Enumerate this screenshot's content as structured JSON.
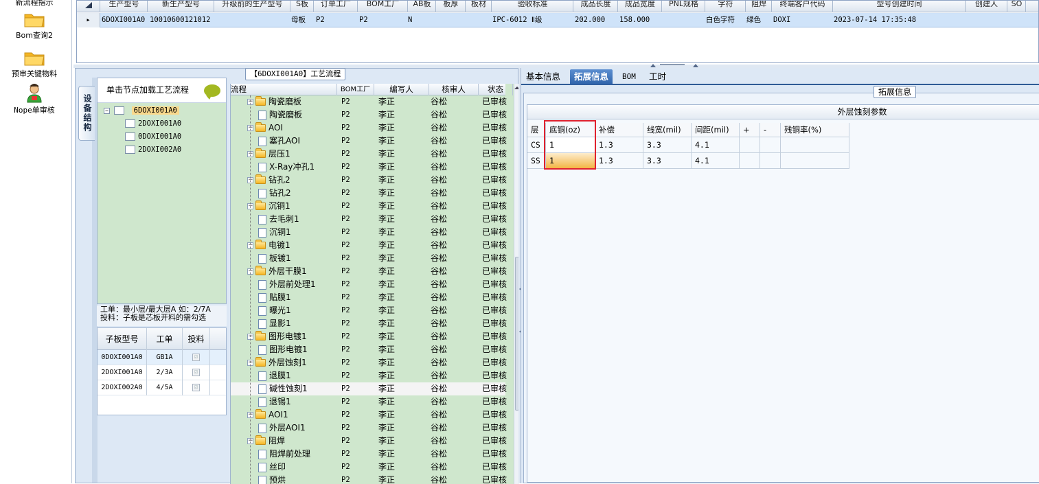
{
  "leftnav": {
    "items": [
      {
        "label": "新流程指示",
        "icon": "folder-icon"
      },
      {
        "label": "Bom查询2",
        "icon": "folder-icon"
      },
      {
        "label": "预审关键物料",
        "icon": "folder-icon"
      },
      {
        "label": "Nope单审核",
        "icon": "user-icon"
      }
    ]
  },
  "topgrid": {
    "columns": [
      "生产型号",
      "新生产型号",
      "升级前的生产型号",
      "S板",
      "订单工厂",
      "BOM工厂",
      "AB板",
      "板厚",
      "板材",
      "验收标准",
      "成品长度",
      "成品宽度",
      "PNL规格",
      "字符",
      "阻焊",
      "终端客户代码",
      "型号创建时间",
      "创建人",
      "SO"
    ],
    "row": {
      "model": "6DOXI001A0",
      "new_model": "10010600121012",
      "s_board": "母板",
      "order_factory": "P2",
      "bom_factory": "P2",
      "ab_board": "N",
      "standard": "IPC-6012 Ⅱ级",
      "length": "202.000",
      "width": "158.000",
      "char": "白色字符",
      "solder": "绿色",
      "customer": "DOXI",
      "created": "2023-07-14 17:35:48"
    }
  },
  "process": {
    "title": "【6DOXI001A0】工艺流程",
    "vtab_label": "设备结构",
    "tree_header": "单击节点加载工艺流程",
    "tree": {
      "root": "6DOXI001A0",
      "children": [
        "2DOXI001A0",
        "0DOXI001A0",
        "2DOXI002A0"
      ]
    },
    "notes": {
      "line1": "工单：最小层/最大层A 如：2/7A",
      "line2": "投料：子板是芯板开料的需勾选"
    },
    "subgrid": {
      "headers": [
        "子板型号",
        "工单",
        "投料"
      ],
      "rows": [
        {
          "model": "0DOXI001A0",
          "order": "GB1A",
          "check": "☑"
        },
        {
          "model": "2DOXI001A0",
          "order": "2/3A",
          "check": "☑"
        },
        {
          "model": "2DOXI002A0",
          "order": "4/5A",
          "check": "☑"
        }
      ]
    },
    "table": {
      "headers": [
        "流程",
        "BOM工厂",
        "编写人",
        "核审人",
        "状态"
      ],
      "rows": [
        {
          "name": "陶瓷磨板",
          "level": 0,
          "factory": "P2",
          "writer": "李正",
          "reviewer": "谷松",
          "status": "已审核"
        },
        {
          "name": "陶瓷磨板",
          "level": 1,
          "factory": "P2",
          "writer": "李正",
          "reviewer": "谷松",
          "status": "已审核"
        },
        {
          "name": "AOI",
          "level": 0,
          "factory": "P2",
          "writer": "李正",
          "reviewer": "谷松",
          "status": "已审核"
        },
        {
          "name": "塞孔AOI",
          "level": 1,
          "factory": "P2",
          "writer": "李正",
          "reviewer": "谷松",
          "status": "已审核"
        },
        {
          "name": "层压1",
          "level": 0,
          "factory": "P2",
          "writer": "李正",
          "reviewer": "谷松",
          "status": "已审核"
        },
        {
          "name": "X-Ray冲孔1",
          "level": 1,
          "factory": "P2",
          "writer": "李正",
          "reviewer": "谷松",
          "status": "已审核"
        },
        {
          "name": "钻孔2",
          "level": 0,
          "factory": "P2",
          "writer": "李正",
          "reviewer": "谷松",
          "status": "已审核"
        },
        {
          "name": "钻孔2",
          "level": 1,
          "factory": "P2",
          "writer": "李正",
          "reviewer": "谷松",
          "status": "已审核"
        },
        {
          "name": "沉铜1",
          "level": 0,
          "factory": "P2",
          "writer": "李正",
          "reviewer": "谷松",
          "status": "已审核"
        },
        {
          "name": "去毛刺1",
          "level": 1,
          "factory": "P2",
          "writer": "李正",
          "reviewer": "谷松",
          "status": "已审核"
        },
        {
          "name": "沉铜1",
          "level": 1,
          "factory": "P2",
          "writer": "李正",
          "reviewer": "谷松",
          "status": "已审核"
        },
        {
          "name": "电镀1",
          "level": 0,
          "factory": "P2",
          "writer": "李正",
          "reviewer": "谷松",
          "status": "已审核"
        },
        {
          "name": "板镀1",
          "level": 1,
          "factory": "P2",
          "writer": "李正",
          "reviewer": "谷松",
          "status": "已审核"
        },
        {
          "name": "外层干膜1",
          "level": 0,
          "factory": "P2",
          "writer": "李正",
          "reviewer": "谷松",
          "status": "已审核"
        },
        {
          "name": "外层前处理1",
          "level": 1,
          "factory": "P2",
          "writer": "李正",
          "reviewer": "谷松",
          "status": "已审核"
        },
        {
          "name": "贴膜1",
          "level": 1,
          "factory": "P2",
          "writer": "李正",
          "reviewer": "谷松",
          "status": "已审核"
        },
        {
          "name": "曝光1",
          "level": 1,
          "factory": "P2",
          "writer": "李正",
          "reviewer": "谷松",
          "status": "已审核"
        },
        {
          "name": "显影1",
          "level": 1,
          "factory": "P2",
          "writer": "李正",
          "reviewer": "谷松",
          "status": "已审核"
        },
        {
          "name": "图形电镀1",
          "level": 0,
          "factory": "P2",
          "writer": "李正",
          "reviewer": "谷松",
          "status": "已审核"
        },
        {
          "name": "图形电镀1",
          "level": 1,
          "factory": "P2",
          "writer": "李正",
          "reviewer": "谷松",
          "status": "已审核"
        },
        {
          "name": "外层蚀刻1",
          "level": 0,
          "factory": "P2",
          "writer": "李正",
          "reviewer": "谷松",
          "status": "已审核"
        },
        {
          "name": "退膜1",
          "level": 1,
          "factory": "P2",
          "writer": "李正",
          "reviewer": "谷松",
          "status": "已审核"
        },
        {
          "name": "碱性蚀刻1",
          "level": 1,
          "factory": "P2",
          "writer": "李正",
          "reviewer": "谷松",
          "status": "已审核",
          "selected": true
        },
        {
          "name": "退锡1",
          "level": 1,
          "factory": "P2",
          "writer": "李正",
          "reviewer": "谷松",
          "status": "已审核"
        },
        {
          "name": "AOI1",
          "level": 0,
          "factory": "P2",
          "writer": "李正",
          "reviewer": "谷松",
          "status": "已审核"
        },
        {
          "name": "外层AOI1",
          "level": 1,
          "factory": "P2",
          "writer": "李正",
          "reviewer": "谷松",
          "status": "已审核"
        },
        {
          "name": "阻焊",
          "level": 0,
          "factory": "P2",
          "writer": "李正",
          "reviewer": "谷松",
          "status": "已审核"
        },
        {
          "name": "阻焊前处理",
          "level": 1,
          "factory": "P2",
          "writer": "李正",
          "reviewer": "谷松",
          "status": "已审核"
        },
        {
          "name": "丝印",
          "level": 1,
          "factory": "P2",
          "writer": "李正",
          "reviewer": "谷松",
          "status": "已审核"
        },
        {
          "name": "预烘",
          "level": 1,
          "factory": "P2",
          "writer": "李正",
          "reviewer": "谷松",
          "status": "已审核"
        }
      ]
    }
  },
  "right": {
    "tabs": [
      "基本信息",
      "拓展信息",
      "BOM",
      "工时"
    ],
    "active_tab": 1,
    "ext_title": "拓展信息",
    "param_title": "外层蚀刻参数",
    "param_headers": [
      "层",
      "底铜(oz)",
      "补偿",
      "线宽(mil)",
      "间距(mil)",
      "+",
      "-",
      "残铜率(%)"
    ],
    "param_rows": [
      [
        "CS",
        "1",
        "1.3",
        "3.3",
        "4.1",
        "",
        "",
        ""
      ],
      [
        "SS",
        "1",
        "1.3",
        "3.3",
        "4.1",
        "",
        "",
        ""
      ]
    ]
  }
}
